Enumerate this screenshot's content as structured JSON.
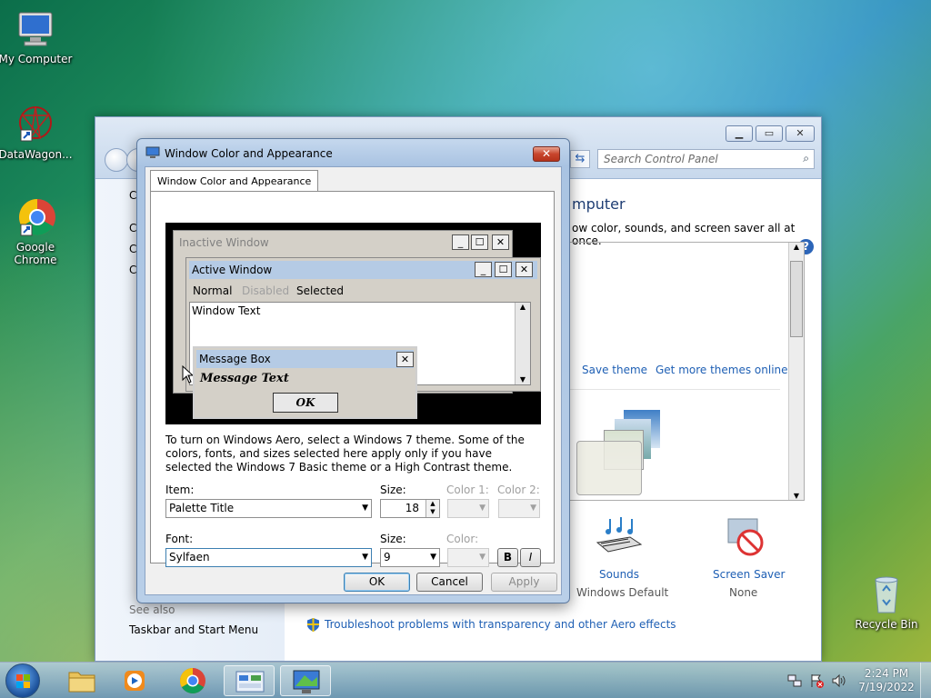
{
  "desktop": {
    "icons": [
      {
        "label": "My Computer",
        "icon": "computer-icon"
      },
      {
        "label": "DataWagon...",
        "icon": "datawagon-icon"
      },
      {
        "label": "Google Chrome",
        "icon": "chrome-icon"
      },
      {
        "label": "Recycle Bin",
        "icon": "recycle-bin-icon"
      }
    ]
  },
  "control_panel": {
    "search_placeholder": "Search Control Panel",
    "left_letters": [
      "C",
      "C",
      "C",
      "C"
    ],
    "heading_partial": "mputer",
    "subheading_partial": "ow color, sounds, and screen saver all at once.",
    "save_theme": "Save theme",
    "get_more_themes": "Get more themes online",
    "sounds_label": "Sounds",
    "sounds_value": "Windows Default",
    "screen_saver_label": "Screen Saver",
    "screen_saver_value": "None",
    "see_also": "See also",
    "taskbar_link": "Taskbar and Start Menu",
    "troubleshoot_link": "Troubleshoot problems with transparency and other Aero effects",
    "help_icon": "?"
  },
  "dialog": {
    "title": "Window Color and Appearance",
    "tab_label": "Window Color and Appearance",
    "preview": {
      "inactive_title": "Inactive Window",
      "active_title": "Active Window",
      "menu_normal": "Normal",
      "menu_disabled": "Disabled",
      "menu_selected": "Selected",
      "window_text": "Window Text",
      "msgbox_title": "Message Box",
      "msgbox_text": "Message Text",
      "ok": "OK"
    },
    "info_text": "To turn on Windows Aero, select a Windows 7 theme.  Some of the colors, fonts, and sizes selected here apply only if you have selected the Windows 7 Basic theme or a High Contrast theme.",
    "item_label": "Item:",
    "item_value": "Palette Title",
    "size_label": "Size:",
    "size_value": "18",
    "color1_label": "Color 1:",
    "color2_label": "Color 2:",
    "font_label": "Font:",
    "font_value": "Sylfaen",
    "font_size_label": "Size:",
    "font_size_value": "9",
    "font_color_label": "Color:",
    "bold": "B",
    "italic": "I",
    "ok": "OK",
    "cancel": "Cancel",
    "apply": "Apply"
  },
  "taskbar": {
    "time": "2:24 PM",
    "date": "7/19/2022"
  }
}
